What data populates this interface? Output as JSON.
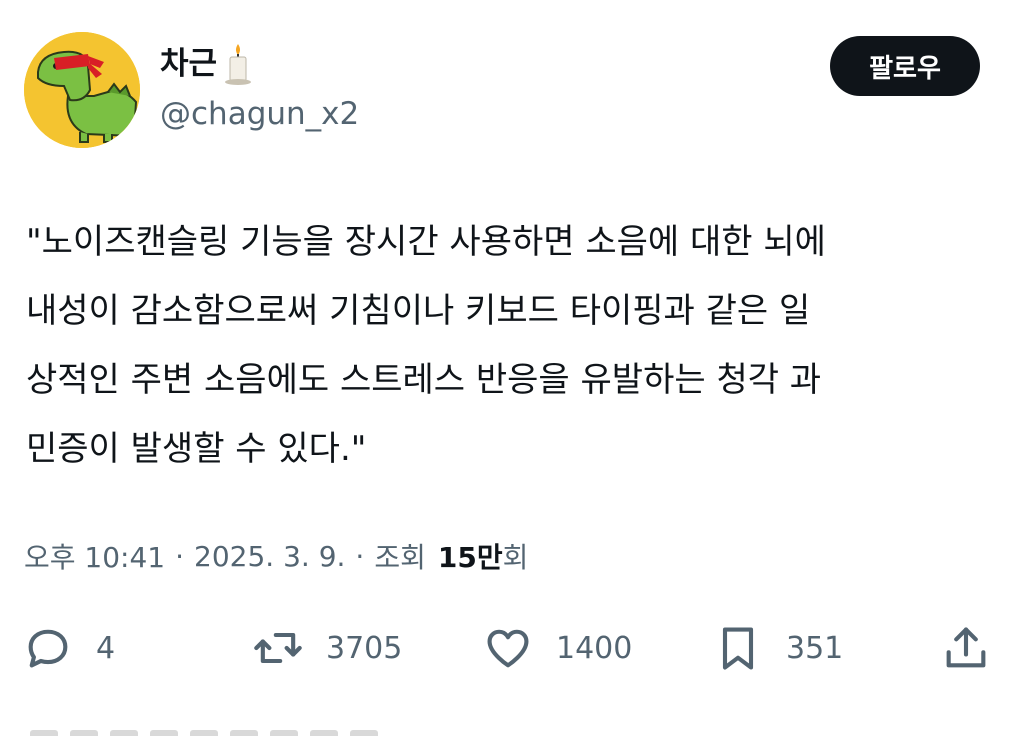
{
  "author": {
    "display_name": "차근",
    "handle": "@chagun_x2",
    "avatar_icon": "dinosaur-avatar-icon",
    "name_emoji_icon": "candle-icon"
  },
  "follow_button": {
    "label": "팔로우"
  },
  "tweet": {
    "text": "\"노이즈캔슬링 기능을 장시간 사용하면 소음에 대한 뇌에\n내성이 감소함으로써 기침이나 키보드 타이핑과 같은 일\n상적인 주변 소음에도 스트레스 반응을 유발하는 청각 과\n민증이 발생할 수 있다.\""
  },
  "meta": {
    "time": "오후 10:41",
    "separator": "·",
    "date": "2025. 3. 9.",
    "views_label_prefix": "조회",
    "views_count": "15만",
    "views_label_suffix": "회"
  },
  "actions": {
    "replies": {
      "icon": "reply-icon",
      "count": "4"
    },
    "retweets": {
      "icon": "retweet-icon",
      "count": "3705"
    },
    "likes": {
      "icon": "heart-icon",
      "count": "1400"
    },
    "bookmarks": {
      "icon": "bookmark-icon",
      "count": "351"
    },
    "share": {
      "icon": "share-icon"
    }
  },
  "colors": {
    "text_primary": "#0f1419",
    "text_secondary": "#536471",
    "button_bg": "#0f1419",
    "avatar_bg": "#f4c430",
    "avatar_dino": "#7bc043",
    "headband": "#d81f26"
  }
}
